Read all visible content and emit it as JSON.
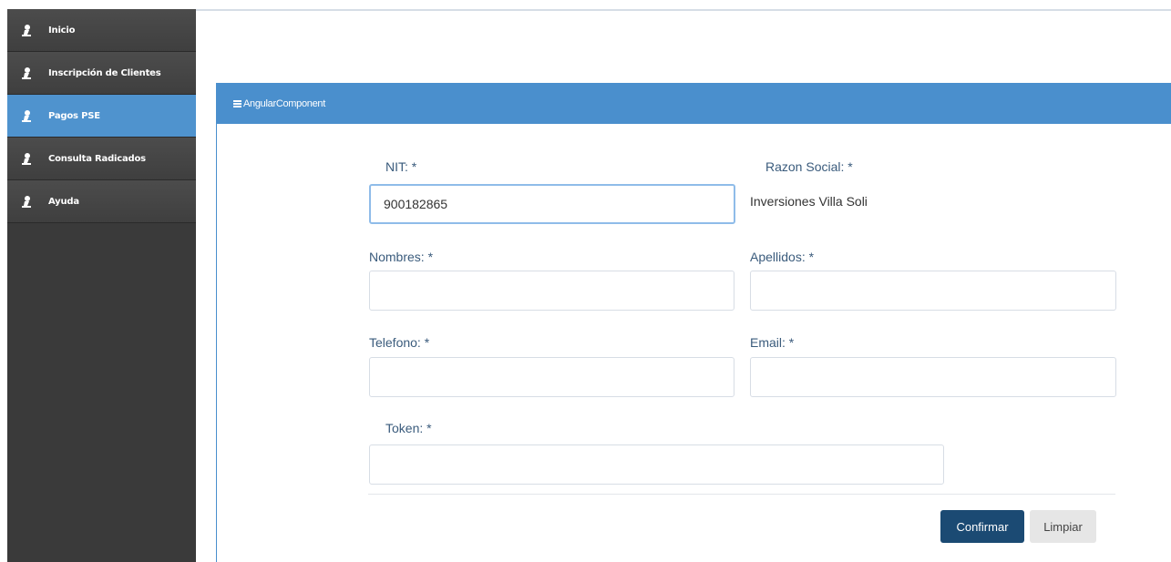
{
  "sidebar": {
    "items": [
      {
        "label": "Inicio",
        "icon": "user-pin-icon"
      },
      {
        "label": "Inscripción de Clientes",
        "icon": "user-pin-icon"
      },
      {
        "label": "Pagos PSE",
        "icon": "user-pin-icon",
        "active": true
      },
      {
        "label": "Consulta Radicados",
        "icon": "user-pin-icon"
      },
      {
        "label": "Ayuda",
        "icon": "user-pin-icon"
      }
    ]
  },
  "panel": {
    "title": "AngularComponent",
    "icon": "menu-icon"
  },
  "form": {
    "nit": {
      "label": "NIT: *",
      "value": "900182865"
    },
    "razon_social": {
      "label": "Razon Social: *",
      "value": "Inversiones Villa Soli"
    },
    "nombres": {
      "label": "Nombres: *",
      "value": ""
    },
    "apellidos": {
      "label": "Apellidos: *",
      "value": ""
    },
    "telefono": {
      "label": "Telefono: *",
      "value": ""
    },
    "email": {
      "label": "Email: *",
      "value": ""
    },
    "token": {
      "label": "Token: *",
      "value": ""
    }
  },
  "actions": {
    "confirm_label": "Confirmar",
    "clear_label": "Limpiar"
  },
  "colors": {
    "accent": "#4a8fcd",
    "sidebar_bg": "#3a3a3a",
    "primary_button": "#1b4a73"
  }
}
